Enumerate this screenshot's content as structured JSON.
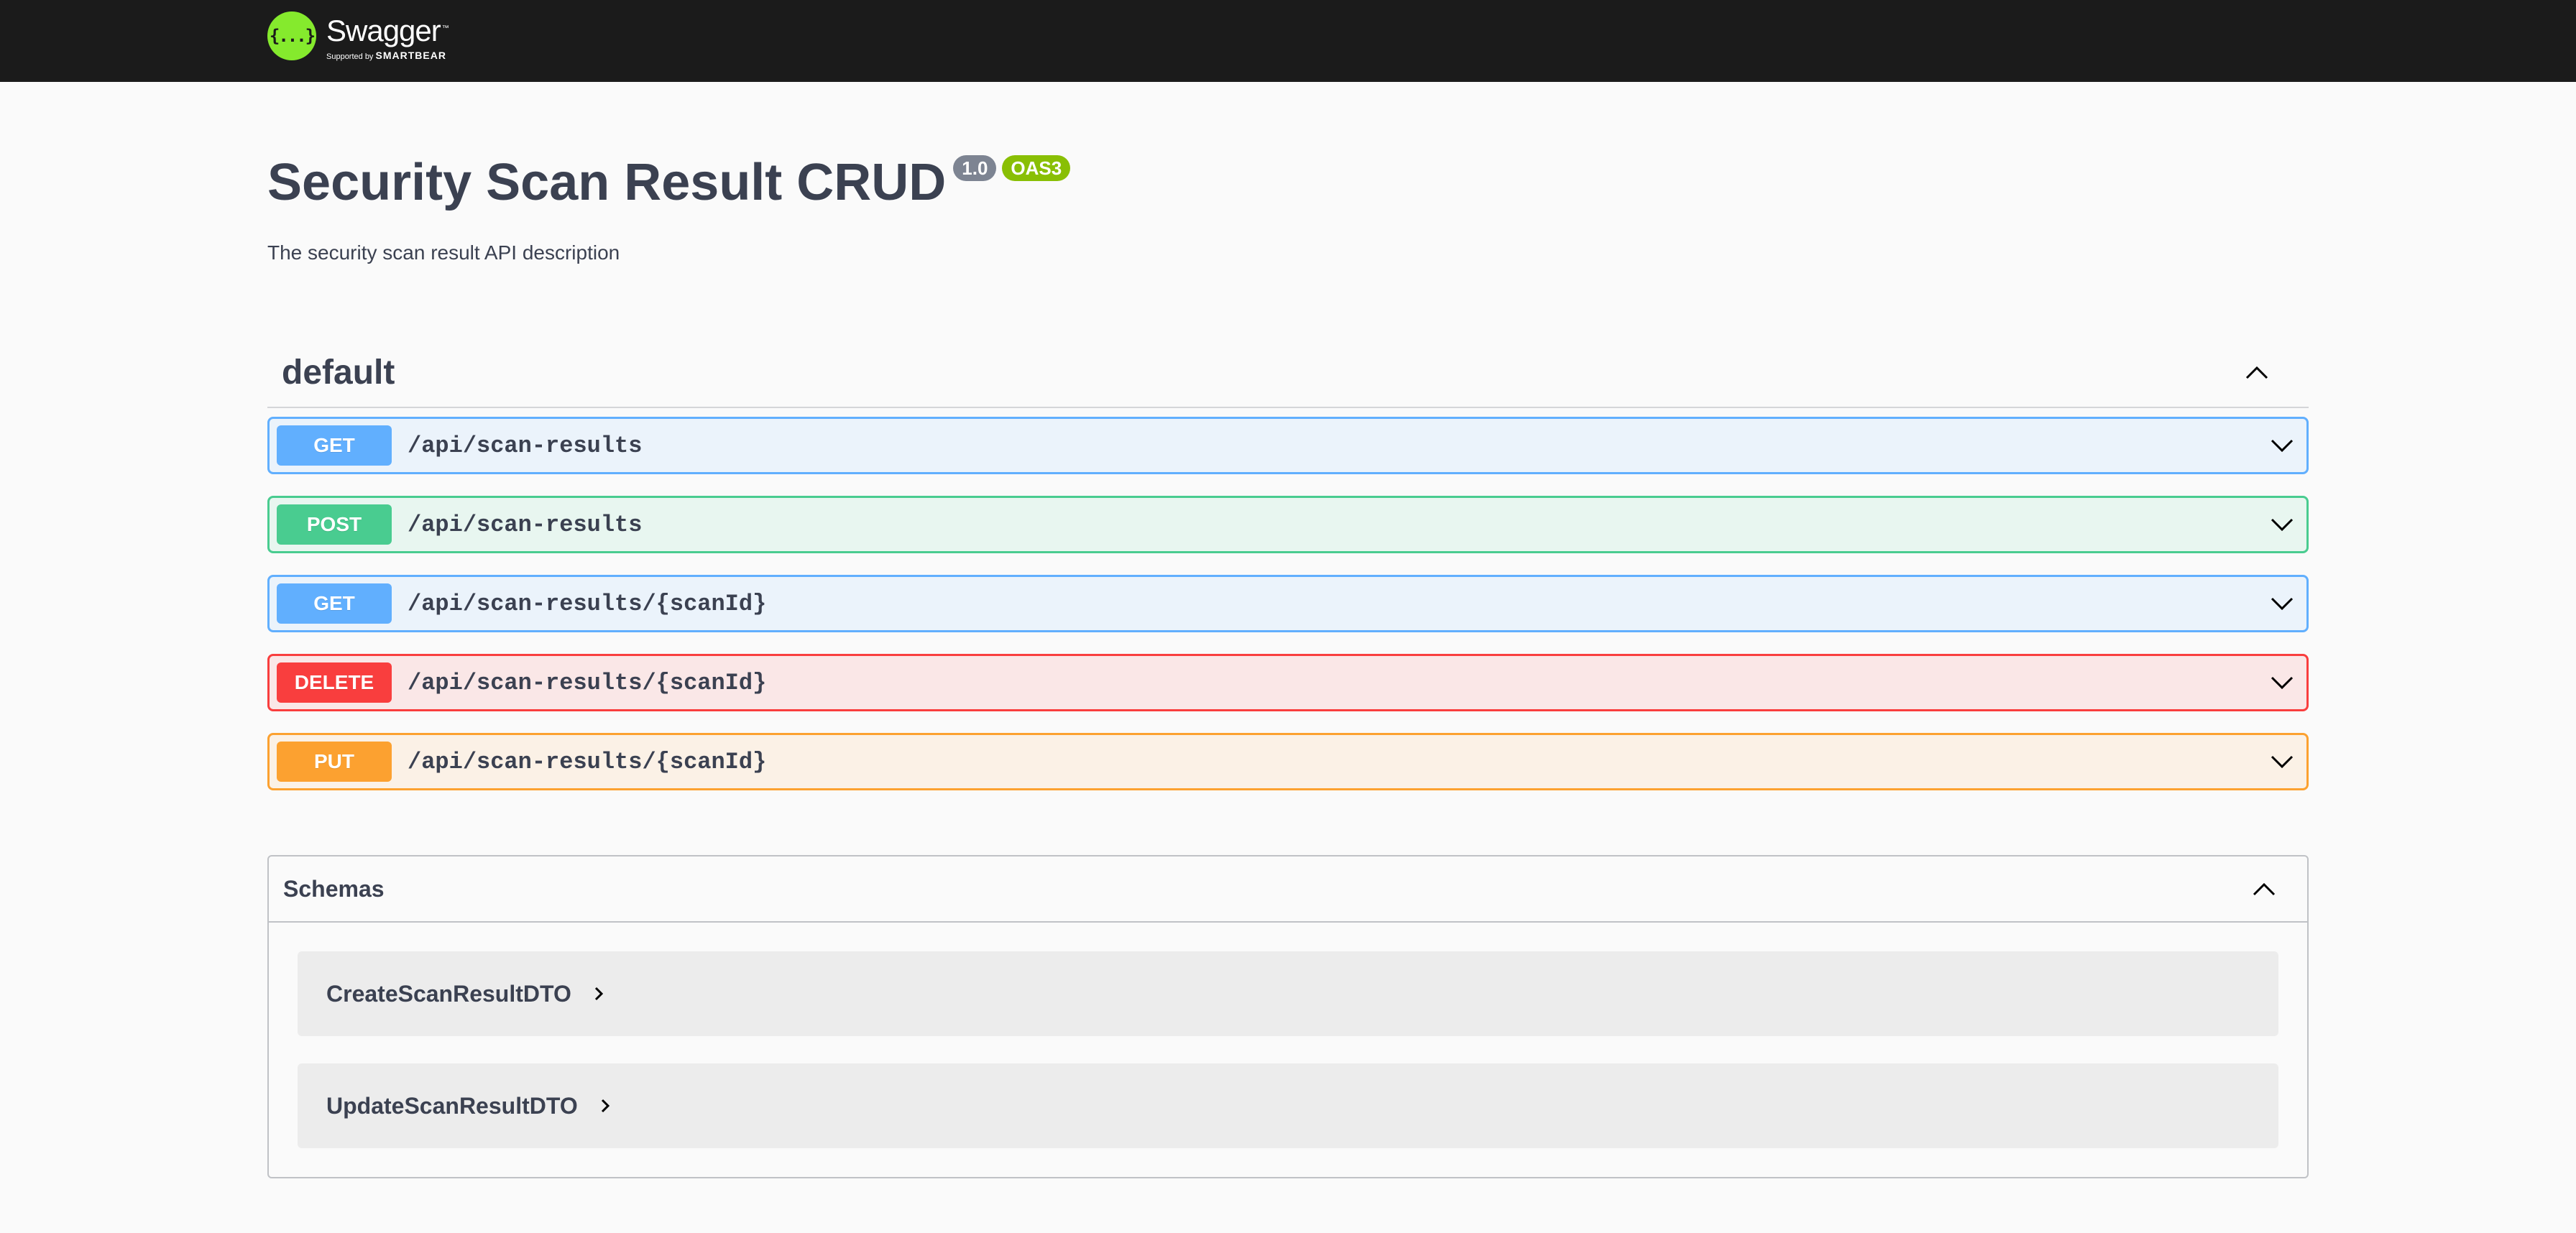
{
  "header": {
    "logo_icon": "{...}",
    "logo_name": "Swagger",
    "logo_sup": "™",
    "logo_supported": "Supported by",
    "logo_smartbear": "SMARTBEAR"
  },
  "info": {
    "title": "Security Scan Result CRUD",
    "version": "1.0",
    "oas": "OAS3",
    "description": "The security scan result API description"
  },
  "tag": {
    "name": "default",
    "operations": [
      {
        "method": "GET",
        "path": "/api/scan-results"
      },
      {
        "method": "POST",
        "path": "/api/scan-results"
      },
      {
        "method": "GET",
        "path": "/api/scan-results/{scanId}"
      },
      {
        "method": "DELETE",
        "path": "/api/scan-results/{scanId}"
      },
      {
        "method": "PUT",
        "path": "/api/scan-results/{scanId}"
      }
    ]
  },
  "schemas": {
    "title": "Schemas",
    "models": [
      "CreateScanResultDTO",
      "UpdateScanResultDTO"
    ]
  },
  "colors": {
    "get": "#61affe",
    "post": "#49cc90",
    "delete": "#f93e3e",
    "put": "#fca130",
    "topbar": "#1b1b1b",
    "logo": "#85ea2d"
  }
}
